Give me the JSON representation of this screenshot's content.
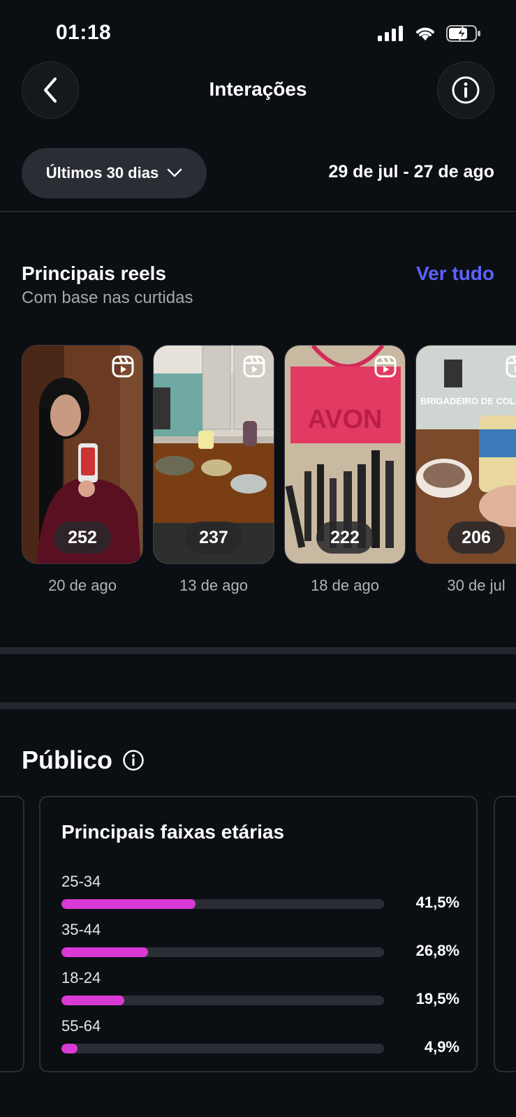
{
  "status_bar": {
    "time": "01:18"
  },
  "header": {
    "title": "Interações"
  },
  "filter": {
    "period_label": "Últimos 30 dias",
    "date_range": "29 de jul - 27 de ago"
  },
  "reels": {
    "title": "Principais reels",
    "subtitle": "Com base nas curtidas",
    "see_all": "Ver tudo",
    "items": [
      {
        "count": "252",
        "date": "20 de ago"
      },
      {
        "count": "237",
        "date": "13 de ago"
      },
      {
        "count": "222",
        "date": "18 de ago",
        "overlay_text": "AVON"
      },
      {
        "count": "206",
        "date": "30 de jul",
        "overlay_text": "BRIGADEIRO DE COLH"
      }
    ]
  },
  "audience": {
    "title": "Público",
    "age_card": {
      "title": "Principais faixas etárias",
      "rows": [
        {
          "label": "25-34",
          "value": "41,5%",
          "fraction": 0.415
        },
        {
          "label": "35-44",
          "value": "26,8%",
          "fraction": 0.268
        },
        {
          "label": "18-24",
          "value": "19,5%",
          "fraction": 0.195
        },
        {
          "label": "55-64",
          "value": "4,9%",
          "fraction": 0.049
        }
      ]
    }
  },
  "colors": {
    "accent_link": "#5b63ff",
    "bar_fill": "#d93ad6",
    "background": "#0b0e13"
  }
}
